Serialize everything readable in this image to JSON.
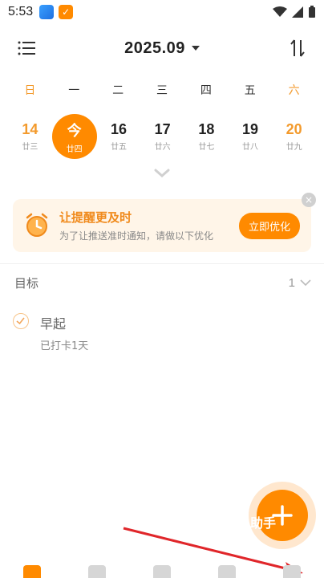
{
  "status": {
    "time": "5:53",
    "app_badge_check": "✓"
  },
  "header": {
    "title": "2025.09"
  },
  "weekdays": [
    "日",
    "一",
    "二",
    "三",
    "四",
    "五",
    "六"
  ],
  "dates": [
    {
      "num": "14",
      "lunar": "廿三"
    },
    {
      "num": "今",
      "lunar": "廿四"
    },
    {
      "num": "16",
      "lunar": "廿五"
    },
    {
      "num": "17",
      "lunar": "廿六"
    },
    {
      "num": "18",
      "lunar": "廿七"
    },
    {
      "num": "19",
      "lunar": "廿八"
    },
    {
      "num": "20",
      "lunar": "廿九"
    }
  ],
  "reminder": {
    "title": "让提醒更及时",
    "subtitle": "为了让推送准时通知，请做以下优化",
    "button": "立即优化",
    "close": "×"
  },
  "goals": {
    "section_title": "目标",
    "count": "1",
    "items": [
      {
        "name": "早起",
        "meta": "已打卡1天"
      }
    ]
  },
  "fab": {
    "assistant_label": "助手"
  },
  "colors": {
    "accent": "#ff8a00",
    "weekend": "#f39a2c",
    "card_bg": "#fff5e8"
  }
}
